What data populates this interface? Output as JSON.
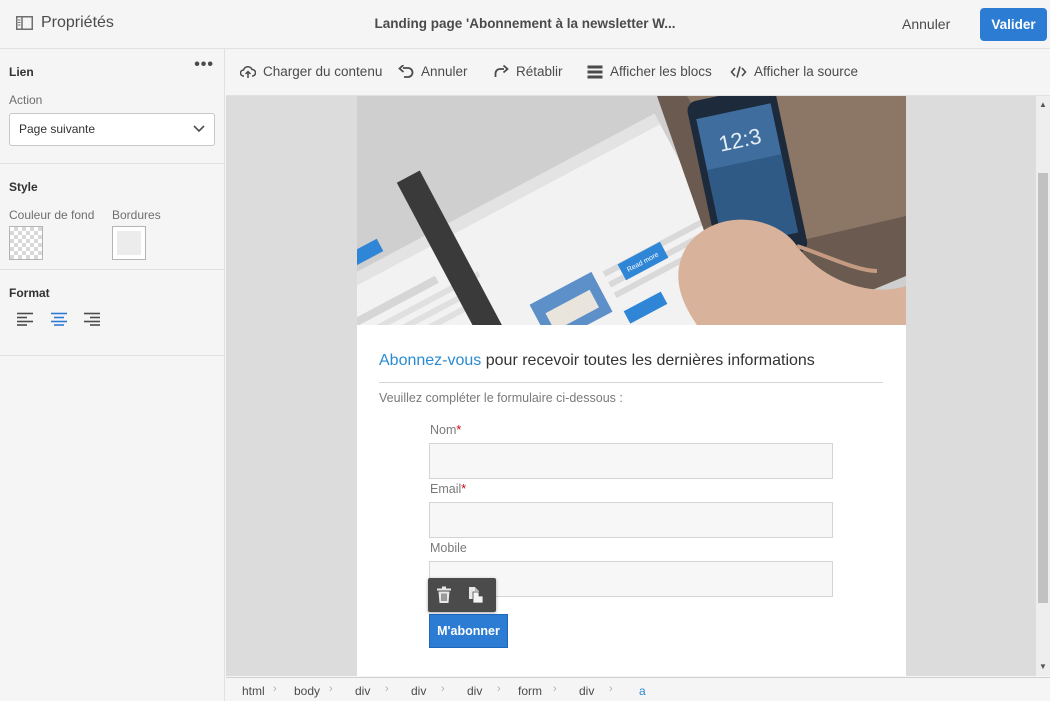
{
  "header": {
    "panel_title": "Propriétés",
    "document_title": "Landing page 'Abonnement à la newsletter W...",
    "cancel_label": "Annuler",
    "validate_label": "Valider"
  },
  "panel": {
    "link": {
      "title": "Lien",
      "more": "•••",
      "action_label": "Action",
      "action_value": "Page suivante"
    },
    "style": {
      "title": "Style",
      "background_label": "Couleur de fond",
      "borders_label": "Bordures"
    },
    "format": {
      "title": "Format",
      "selected_alignment": "center"
    }
  },
  "toolbar": {
    "load_content": "Charger du contenu",
    "undo": "Annuler",
    "redo": "Rétablir",
    "show_blocks": "Afficher les blocs",
    "show_source": "Afficher la source"
  },
  "content": {
    "heading_accent": "Abonnez-vous",
    "heading_rest": " pour recevoir toutes les dernières informations",
    "intro": "Veuillez compléter le formulaire ci-dessous :",
    "fields": [
      {
        "label": "Nom",
        "required": "*",
        "value": ""
      },
      {
        "label": "Email",
        "required": "*",
        "value": ""
      },
      {
        "label": "Mobile",
        "required": "",
        "value": ""
      }
    ],
    "submit_label": "M'abonner",
    "hero_texts": {
      "clock": "12:3",
      "read_more": "Read more"
    }
  },
  "breadcrumb": [
    "html",
    "body",
    "div",
    "div",
    "div",
    "form",
    "div",
    "a"
  ],
  "colors": {
    "accent": "#2d7cd3",
    "link": "#2a8bd2",
    "required": "#d0021b"
  }
}
